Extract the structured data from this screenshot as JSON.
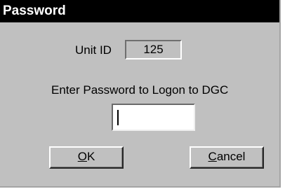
{
  "window": {
    "title": "Password"
  },
  "unit": {
    "label": "Unit ID",
    "value": "125"
  },
  "prompt": {
    "text": "Enter Password to Logon to DGC"
  },
  "password_field": {
    "value": ""
  },
  "buttons": {
    "ok": {
      "mnemonic": "O",
      "rest": "K"
    },
    "cancel": {
      "mnemonic": "C",
      "rest": "ancel"
    }
  }
}
